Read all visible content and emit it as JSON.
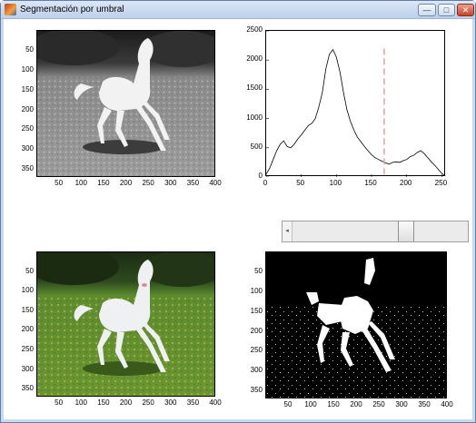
{
  "window": {
    "title": "Segmentación por umbral",
    "minimize_glyph": "—",
    "maximize_glyph": "□",
    "close_glyph": "✕",
    "icon": "matlab-figure-icon"
  },
  "colors": {
    "histogram_line": "#000000",
    "threshold_line": "#e8a0a0",
    "binary_background": "#000000",
    "binary_foreground": "#ffffff",
    "grass_green": "#5a8a2e",
    "tree_dark": "#203418"
  },
  "top_left_image": {
    "description_icon": "grayscale-horse-image",
    "y_ticks": [
      "50",
      "100",
      "150",
      "200",
      "250",
      "300",
      "350"
    ],
    "x_ticks": [
      "50",
      "100",
      "150",
      "200",
      "250",
      "300",
      "350",
      "400"
    ]
  },
  "histogram": {
    "threshold": 168,
    "y_ticks": [
      "0",
      "500",
      "1000",
      "1500",
      "2000",
      "2500"
    ],
    "x_ticks": [
      "0",
      "50",
      "100",
      "150",
      "200",
      "250"
    ]
  },
  "slider": {
    "left_arrow": "◂",
    "value_fraction": 0.66
  },
  "bottom_left_image": {
    "description_icon": "color-horse-image",
    "y_ticks": [
      "50",
      "100",
      "150",
      "200",
      "250",
      "300",
      "350"
    ],
    "x_ticks": [
      "50",
      "100",
      "150",
      "200",
      "250",
      "300",
      "350",
      "400"
    ]
  },
  "bottom_right_image": {
    "description_icon": "binary-horse-image",
    "y_ticks": [
      "50",
      "100",
      "150",
      "200",
      "250",
      "300",
      "350"
    ],
    "x_ticks": [
      "50",
      "100",
      "150",
      "200",
      "250",
      "300",
      "350",
      "400"
    ]
  },
  "chart_data": {
    "type": "line",
    "x": [
      0,
      5,
      10,
      15,
      20,
      25,
      30,
      35,
      40,
      45,
      50,
      55,
      60,
      65,
      70,
      75,
      80,
      85,
      90,
      95,
      100,
      105,
      110,
      115,
      120,
      125,
      130,
      135,
      140,
      145,
      150,
      155,
      160,
      165,
      170,
      175,
      180,
      185,
      190,
      195,
      200,
      205,
      210,
      215,
      220,
      225,
      230,
      235,
      240,
      245,
      250,
      255
    ],
    "series": [
      {
        "values": [
          50,
          150,
          300,
          450,
          560,
          620,
          520,
          500,
          560,
          650,
          720,
          800,
          880,
          920,
          1000,
          1200,
          1450,
          1850,
          2100,
          2180,
          2050,
          1800,
          1450,
          1150,
          950,
          800,
          680,
          600,
          520,
          450,
          380,
          330,
          300,
          270,
          240,
          220,
          250,
          260,
          250,
          280,
          300,
          350,
          370,
          420,
          450,
          400,
          330,
          260,
          200,
          130,
          60,
          20
        ]
      }
    ],
    "threshold_x": 168,
    "xlim": [
      0,
      256
    ],
    "ylim": [
      0,
      2500
    ],
    "x_ticks": [
      0,
      50,
      100,
      150,
      200,
      250
    ],
    "y_ticks": [
      0,
      500,
      1000,
      1500,
      2000,
      2500
    ],
    "grid": false
  }
}
